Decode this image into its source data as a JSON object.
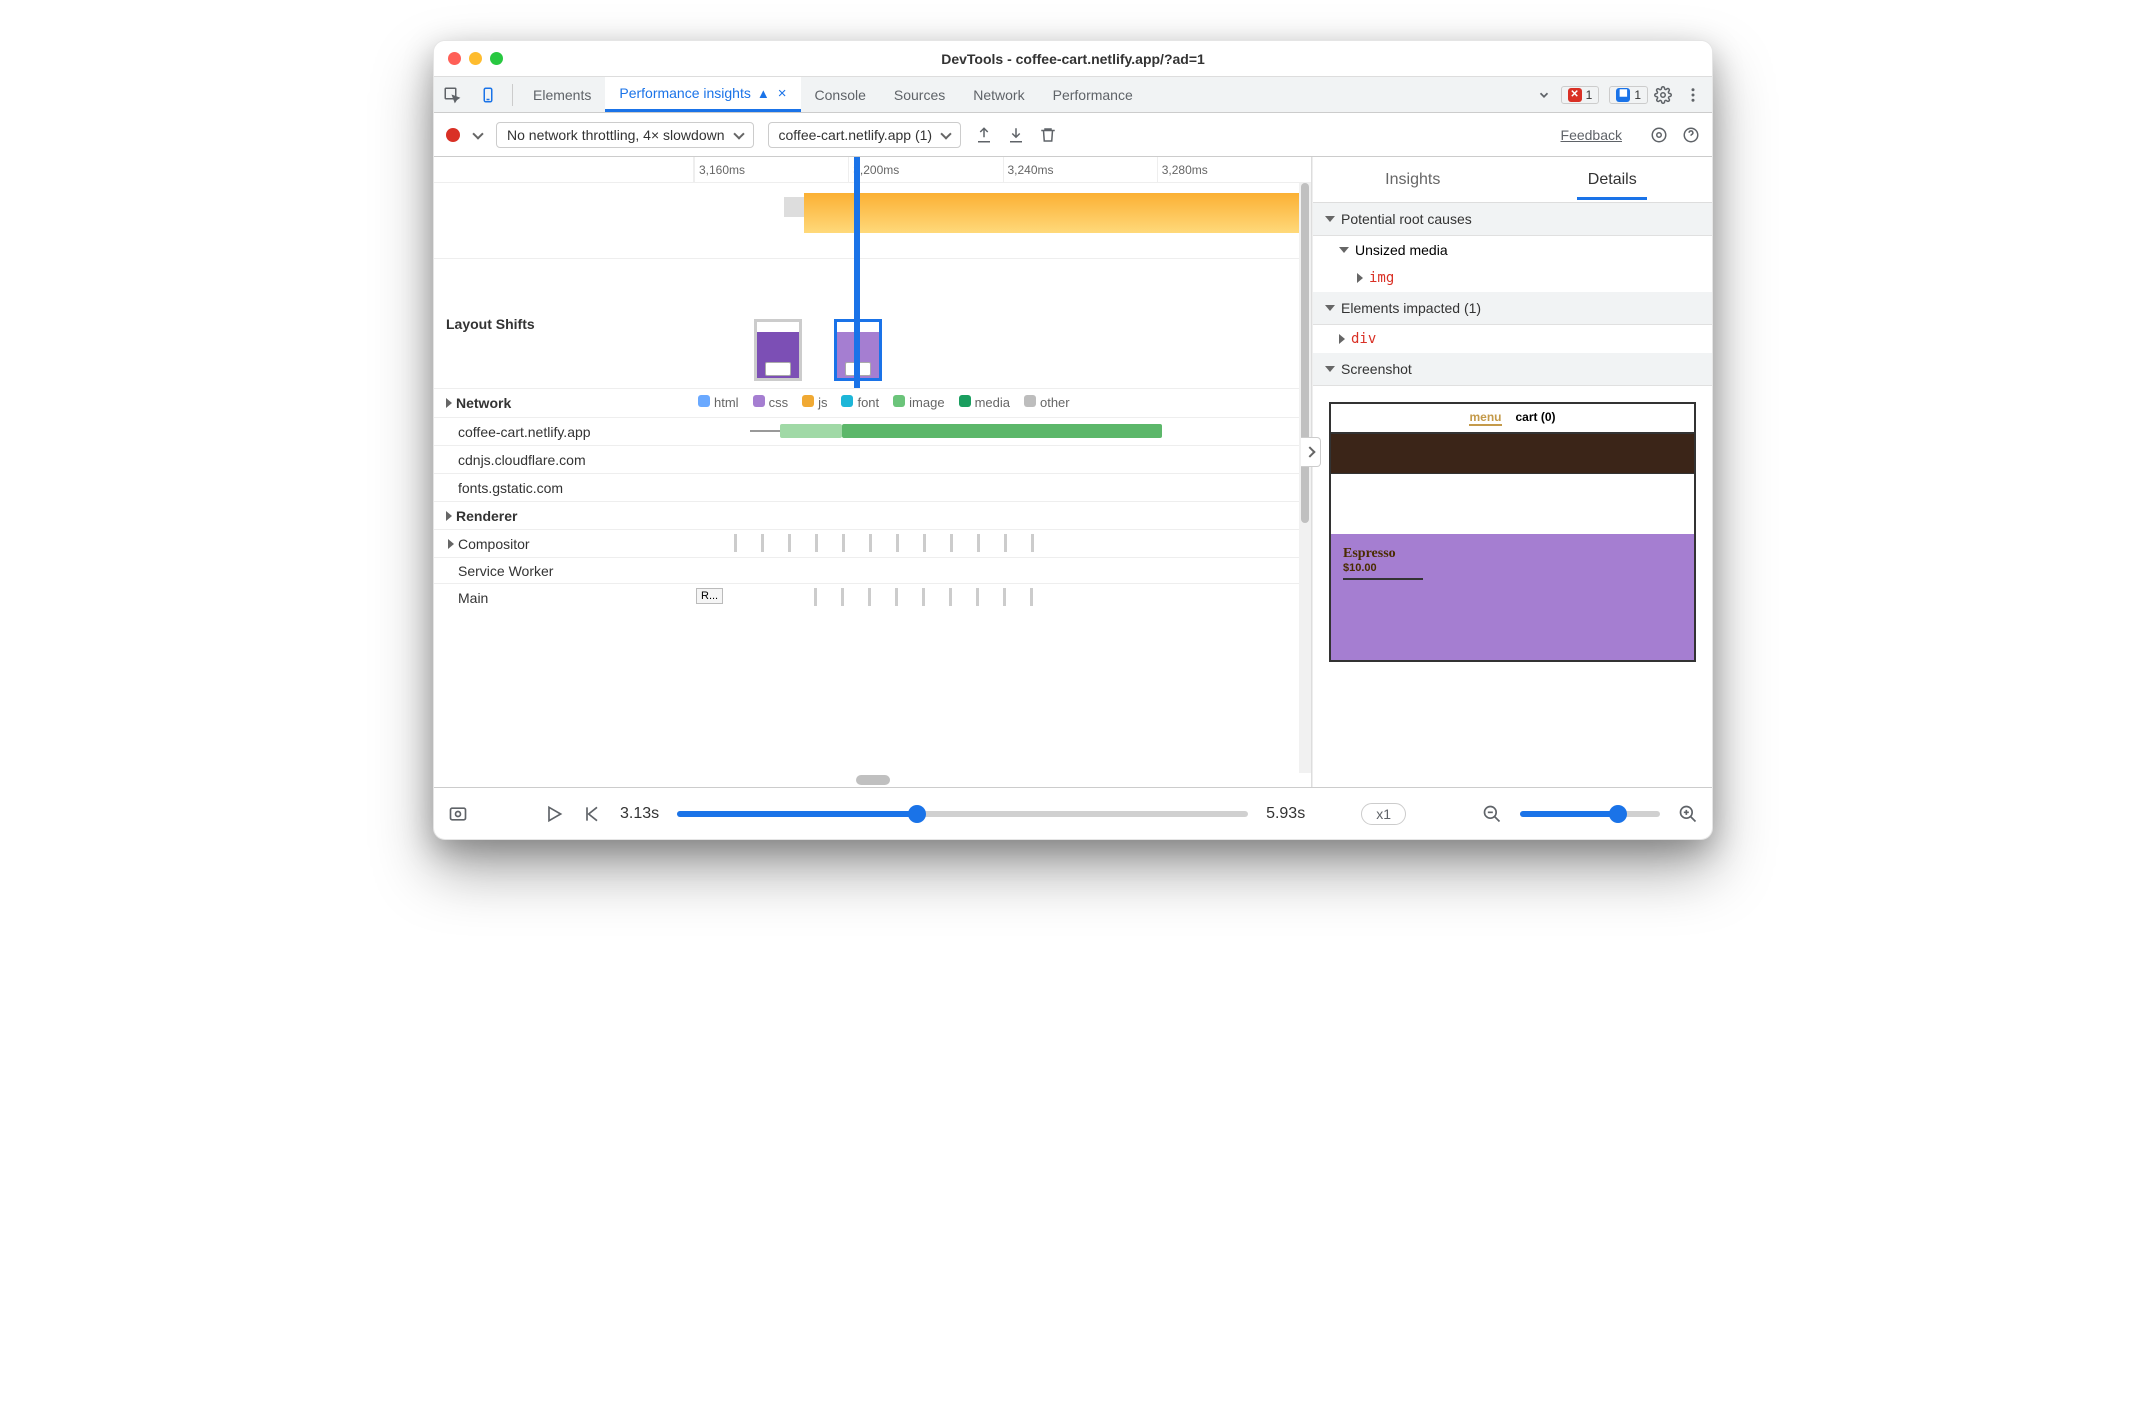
{
  "title": "DevTools - coffee-cart.netlify.app/?ad=1",
  "tabs": [
    "Elements",
    "Performance insights",
    "Console",
    "Sources",
    "Network",
    "Performance"
  ],
  "active_tab": 1,
  "error_count": "1",
  "message_count": "1",
  "throttle": "No network throttling, 4× slowdown",
  "recording": "coffee-cart.netlify.app (1)",
  "feedback": "Feedback",
  "ruler": [
    "3,160ms",
    "3,200ms",
    "3,240ms",
    "3,280ms"
  ],
  "layout_shifts_label": "Layout Shifts",
  "network_label": "Network",
  "renderer_label": "Renderer",
  "compositor_label": "Compositor",
  "service_worker_label": "Service Worker",
  "main_label": "Main",
  "main_block": "R...",
  "legend": {
    "html": "html",
    "css": "css",
    "js": "js",
    "font": "font",
    "image": "image",
    "media": "media",
    "other": "other"
  },
  "legend_colors": {
    "html": "#6aa9ff",
    "css": "#a57ed1",
    "js": "#f0a933",
    "font": "#1db6d8",
    "image": "#6bc47a",
    "media": "#1a9e5f",
    "other": "#bdbdbd"
  },
  "network_hosts": [
    "coffee-cart.netlify.app",
    "cdnjs.cloudflare.com",
    "fonts.gstatic.com"
  ],
  "right_tabs": {
    "insights": "Insights",
    "details": "Details"
  },
  "potential_root_causes": "Potential root causes",
  "unsized_media": "Unsized media",
  "img_el": "img",
  "elements_impacted": "Elements impacted (1)",
  "div_el": "div",
  "screenshot_label": "Screenshot",
  "ss": {
    "menu": "menu",
    "cart": "cart (0)",
    "product": "Espresso",
    "price": "$10.00"
  },
  "footer": {
    "t0": "3.13s",
    "t1": "5.93s",
    "zoom": "x1"
  }
}
